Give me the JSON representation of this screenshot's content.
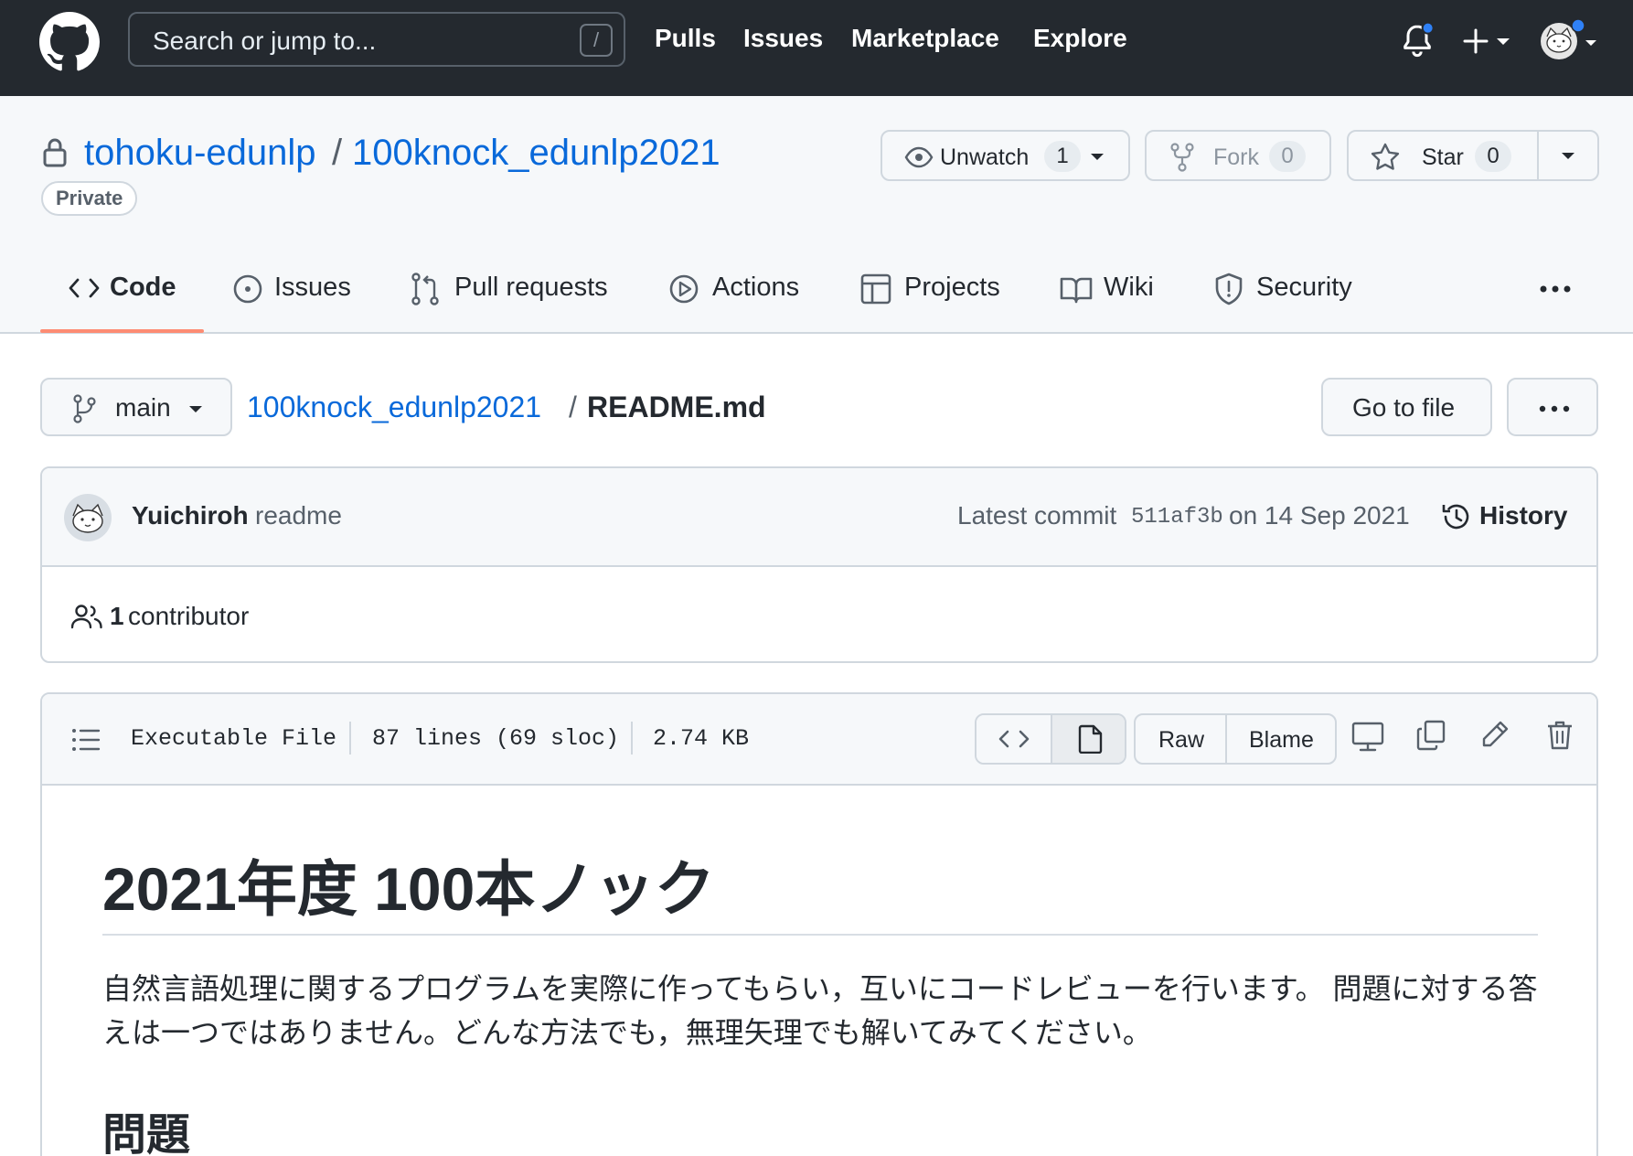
{
  "header": {
    "search_placeholder": "Search or jump to...",
    "search_shortcut": "/",
    "nav": [
      "Pulls",
      "Issues",
      "Marketplace",
      "Explore"
    ]
  },
  "repo": {
    "owner": "tohoku-edunlp",
    "separator": "/",
    "name": "100knock_edunlp2021",
    "visibility": "Private",
    "unwatch_label": "Unwatch",
    "watch_count": "1",
    "fork_label": "Fork",
    "fork_count": "0",
    "star_label": "Star",
    "star_count": "0"
  },
  "tabs": [
    {
      "label": "Code",
      "icon": "code-icon"
    },
    {
      "label": "Issues",
      "icon": "issue-opened-icon"
    },
    {
      "label": "Pull requests",
      "icon": "git-pull-request-icon"
    },
    {
      "label": "Actions",
      "icon": "play-icon"
    },
    {
      "label": "Projects",
      "icon": "table-icon"
    },
    {
      "label": "Wiki",
      "icon": "book-icon"
    },
    {
      "label": "Security",
      "icon": "shield-icon"
    }
  ],
  "file_nav": {
    "branch": "main",
    "repo_crumb": "100knock_edunlp2021",
    "separator": "/",
    "file_name": "README.md",
    "go_to_file": "Go to file"
  },
  "commit": {
    "author": "Yuichiroh",
    "message": "readme",
    "latest_prefix": "Latest commit",
    "sha": "511af3b",
    "date_text": "on 14 Sep 2021",
    "history_label": "History",
    "contributors_count": "1",
    "contributors_label": "contributor"
  },
  "file": {
    "mode": "Executable File",
    "lines": "87 lines (69 sloc)",
    "size": "2.74 KB",
    "raw_label": "Raw",
    "blame_label": "Blame"
  },
  "readme": {
    "h1": "2021年度 100本ノック",
    "paragraph": "自然言語処理に関するプログラムを実際に作ってもらい，互いにコードレビューを行います。 問題に対する答えは一つではありません。どんな方法でも，無理矢理でも解いてみてください。",
    "h2": "問題"
  },
  "colors": {
    "header_bg": "#24292f",
    "link": "#0969da",
    "active_tab_underline": "#fd8c73",
    "notification_dot": "#2f81f7"
  }
}
